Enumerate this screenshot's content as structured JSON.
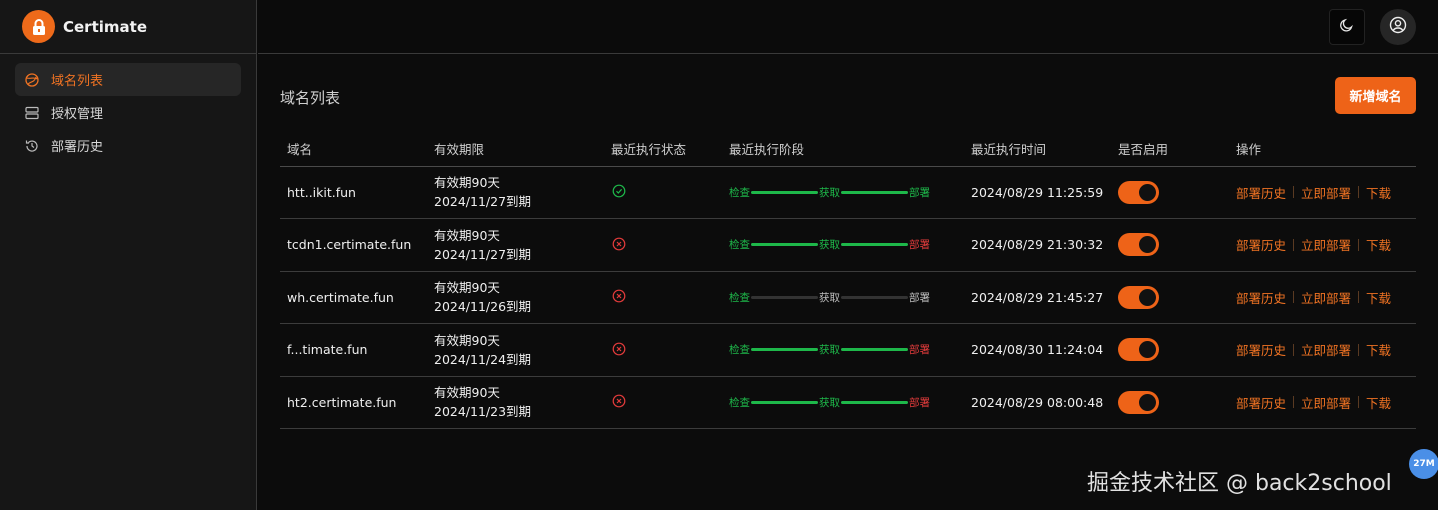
{
  "app": {
    "name": "Certimate"
  },
  "sidebar": {
    "items": [
      {
        "label": "域名列表",
        "icon": "globe-icon",
        "active": true
      },
      {
        "label": "授权管理",
        "icon": "server-icon",
        "active": false
      },
      {
        "label": "部署历史",
        "icon": "history-icon",
        "active": false
      }
    ]
  },
  "header": {
    "theme_icon": "moon-icon",
    "user_icon": "user-circle-icon"
  },
  "main": {
    "title": "域名列表",
    "add_button": "新增域名",
    "columns": [
      "域名",
      "有效期限",
      "最近执行状态",
      "最近执行阶段",
      "最近执行时间",
      "是否启用",
      "操作"
    ],
    "rows": [
      {
        "domain": "htt..ikit.fun",
        "validity": "有效期90天",
        "expiry": "2024/11/27到期",
        "status": "success",
        "stages": [
          "检查",
          "获取",
          "部署"
        ],
        "stage_state": [
          "g",
          "g",
          "g"
        ],
        "time": "2024/08/29 11:25:59",
        "enabled": true
      },
      {
        "domain": "tcdn1.certimate.fun",
        "validity": "有效期90天",
        "expiry": "2024/11/27到期",
        "status": "failed",
        "stages": [
          "检查",
          "获取",
          "部署"
        ],
        "stage_state": [
          "g",
          "g",
          "r"
        ],
        "time": "2024/08/29 21:30:32",
        "enabled": true
      },
      {
        "domain": "wh.certimate.fun",
        "validity": "有效期90天",
        "expiry": "2024/11/26到期",
        "status": "failed",
        "stages": [
          "检查",
          "获取",
          "部署"
        ],
        "stage_state": [
          "g",
          "n",
          "n"
        ],
        "time": "2024/08/29 21:45:27",
        "enabled": true
      },
      {
        "domain": "f...timate.fun",
        "validity": "有效期90天",
        "expiry": "2024/11/24到期",
        "status": "failed",
        "stages": [
          "检查",
          "获取",
          "部署"
        ],
        "stage_state": [
          "g",
          "g",
          "r"
        ],
        "time": "2024/08/30 11:24:04",
        "enabled": true
      },
      {
        "domain": "ht2.certimate.fun",
        "validity": "有效期90天",
        "expiry": "2024/11/23到期",
        "status": "failed",
        "stages": [
          "检查",
          "获取",
          "部署"
        ],
        "stage_state": [
          "g",
          "g",
          "r"
        ],
        "time": "2024/08/29 08:00:48",
        "enabled": true
      }
    ],
    "actions": [
      "部署历史",
      "立即部署",
      "下载"
    ]
  },
  "overlay": {
    "watermark": "掘金技术社区 @ back2school",
    "badge": "27M"
  },
  "colors": {
    "accent": "#ee6318",
    "success": "#1eb84a",
    "error": "#e23b3b"
  }
}
